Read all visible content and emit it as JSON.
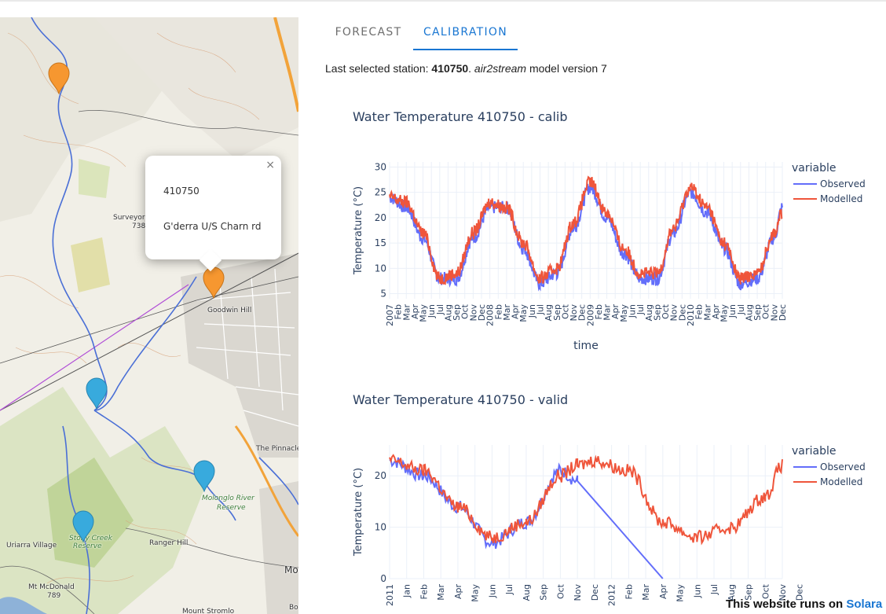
{
  "map": {
    "labels": {
      "surveyor": "Surveyor",
      "surveyor_num": "738",
      "goodwin": "Goodwin Hill",
      "pinnacle": "The Pinnacle",
      "molonglo": "Molonglo River",
      "reserve1": "Reserve",
      "stony": "Stony Creek",
      "reserve2": "Reserve",
      "uriarra": "Uriarra Village",
      "ranger": "Ranger Hill",
      "mcdonald": "Mt McDonald",
      "mcdonald_num": "789",
      "stromlo": "Mount Stromlo",
      "mo": "Mo",
      "bo": "Bo"
    },
    "popup": {
      "close": "×",
      "station_id": "410750",
      "station_name": "G'derra U/S Charn rd"
    },
    "colors": {
      "orange_marker": "#f69730",
      "blue_marker": "#38aadd"
    }
  },
  "tabs": [
    "FORECAST",
    "CALIBRATION"
  ],
  "active_tab": "CALIBRATION",
  "station_info": {
    "prefix": "Last selected station: ",
    "station": "410750",
    "sep": ". ",
    "model": "air2stream",
    "suffix": " model version 7"
  },
  "charts": [
    {
      "title": "Water Temperature 410750 - calib",
      "ylabel": "Temperature (°C)",
      "xlabel": "time",
      "legend_title": "variable",
      "legend": [
        "Observed",
        "Modelled"
      ],
      "yticks": [
        "30",
        "25",
        "20",
        "15",
        "10",
        "5"
      ],
      "xticks": [
        "2007",
        "Feb",
        "Mar",
        "Apr",
        "May",
        "Jun",
        "Jul",
        "Aug",
        "Sep",
        "Oct",
        "Nov",
        "Dec",
        "2008",
        "Feb",
        "Mar",
        "Apr",
        "May",
        "Jun",
        "Jul",
        "Aug",
        "Sep",
        "Oct",
        "Nov",
        "Dec",
        "2009",
        "Feb",
        "Mar",
        "Apr",
        "May",
        "Jun",
        "Jul",
        "Aug",
        "Sep",
        "Oct",
        "Nov",
        "Dec",
        "2010",
        "Feb",
        "Mar",
        "Apr",
        "May",
        "Jun",
        "Jul",
        "Aug",
        "Sep",
        "Oct",
        "Nov",
        "Dec"
      ]
    },
    {
      "title": "Water Temperature 410750 - valid",
      "ylabel": "Temperature (°C)",
      "legend_title": "variable",
      "legend": [
        "Observed",
        "Modelled"
      ],
      "yticks": [
        "20",
        "10",
        "0"
      ],
      "xticks": [
        "2011",
        "Jan",
        "Feb",
        "Mar",
        "Apr",
        "May",
        "Jun",
        "Jul",
        "Aug",
        "Sep",
        "Oct",
        "Nov",
        "Dec",
        "2012",
        "Feb",
        "Mar",
        "Apr",
        "May",
        "Jun",
        "Jul",
        "Aug",
        "Sep",
        "Oct",
        "Nov",
        "Dec"
      ]
    }
  ],
  "chart_data": [
    {
      "type": "line",
      "title": "Water Temperature 410750 - calib",
      "xlabel": "time",
      "ylabel": "Temperature (°C)",
      "ylim": [
        4,
        31
      ],
      "x_range": [
        "2007-01",
        "2010-12"
      ],
      "x": [
        "2007-01",
        "2007-03",
        "2007-05",
        "2007-07",
        "2007-09",
        "2007-11",
        "2008-01",
        "2008-03",
        "2008-05",
        "2008-07",
        "2008-09",
        "2008-11",
        "2009-01",
        "2009-03",
        "2009-05",
        "2009-07",
        "2009-09",
        "2009-11",
        "2010-01",
        "2010-03",
        "2010-05",
        "2010-07",
        "2010-09",
        "2010-11",
        "2010-12"
      ],
      "series": [
        {
          "name": "Observed",
          "color": "#636efa",
          "values": [
            24,
            22,
            16,
            8,
            8,
            16,
            22,
            22,
            14,
            7,
            9,
            18,
            26,
            20,
            13,
            8,
            8,
            17,
            25,
            21,
            14,
            7,
            8,
            16,
            22
          ]
        },
        {
          "name": "Modelled",
          "color": "#ef553b",
          "values": [
            24,
            23,
            17,
            8,
            9,
            17,
            23,
            22,
            15,
            8,
            10,
            19,
            27,
            21,
            14,
            9,
            9,
            18,
            26,
            22,
            15,
            8,
            9,
            17,
            21
          ]
        }
      ],
      "legend_title": "variable",
      "grid": true,
      "legend_position": "right"
    },
    {
      "type": "line",
      "title": "Water Temperature 410750 - valid",
      "ylabel": "Temperature (°C)",
      "ylim": [
        0,
        26
      ],
      "x_range": [
        "2011-01",
        "2012-12"
      ],
      "x": [
        "2011-01",
        "2011-03",
        "2011-05",
        "2011-07",
        "2011-09",
        "2011-11",
        "2011-12",
        "2012-01",
        "2012-03",
        "2012-05",
        "2012-07",
        "2012-09",
        "2012-11",
        "2012-12"
      ],
      "series": [
        {
          "name": "Observed",
          "color": "#636efa",
          "values": [
            23,
            20,
            14,
            7,
            11,
            21,
            19,
            null,
            null,
            0,
            null,
            null,
            null,
            null
          ],
          "note_gap": "line drawn straight from 2011-12 to 2012-05 at 0"
        },
        {
          "name": "Modelled",
          "color": "#ef553b",
          "values": [
            23,
            21,
            14,
            8,
            11,
            20,
            22,
            23,
            21,
            11,
            8,
            10,
            16,
            22
          ]
        }
      ],
      "legend_title": "variable",
      "grid": true,
      "legend_position": "right"
    }
  ],
  "footer": {
    "text": "This website runs on ",
    "link": "Solara"
  }
}
